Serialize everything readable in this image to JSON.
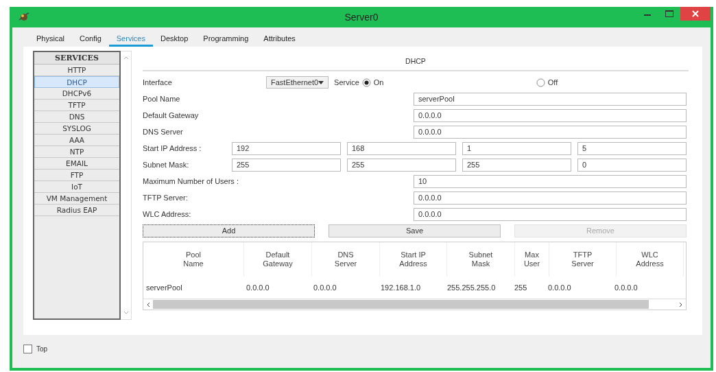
{
  "window": {
    "title": "Server0"
  },
  "tabs": [
    {
      "label": "Physical",
      "selected": false
    },
    {
      "label": "Config",
      "selected": false
    },
    {
      "label": "Services",
      "selected": true
    },
    {
      "label": "Desktop",
      "selected": false
    },
    {
      "label": "Programming",
      "selected": false
    },
    {
      "label": "Attributes",
      "selected": false
    }
  ],
  "sidebar": {
    "title": "SERVICES",
    "items": [
      {
        "label": "HTTP",
        "selected": false
      },
      {
        "label": "DHCP",
        "selected": true
      },
      {
        "label": "DHCPv6",
        "selected": false
      },
      {
        "label": "TFTP",
        "selected": false
      },
      {
        "label": "DNS",
        "selected": false
      },
      {
        "label": "SYSLOG",
        "selected": false
      },
      {
        "label": "AAA",
        "selected": false
      },
      {
        "label": "NTP",
        "selected": false
      },
      {
        "label": "EMAIL",
        "selected": false
      },
      {
        "label": "FTP",
        "selected": false
      },
      {
        "label": "IoT",
        "selected": false
      },
      {
        "label": "VM Management",
        "selected": false
      },
      {
        "label": "Radius EAP",
        "selected": false
      }
    ]
  },
  "panel": {
    "heading": "DHCP",
    "interface": {
      "label": "Interface",
      "value": "FastEthernet0"
    },
    "service": {
      "label": "Service",
      "options": [
        {
          "label": "On",
          "selected": true
        },
        {
          "label": "Off",
          "selected": false
        }
      ]
    },
    "rows": [
      {
        "kind": "text",
        "label": "Pool Name",
        "value": "serverPool"
      },
      {
        "kind": "text",
        "label": "Default Gateway",
        "value": "0.0.0.0"
      },
      {
        "kind": "text",
        "label": "DNS Server",
        "value": "0.0.0.0"
      },
      {
        "kind": "octets",
        "label": "Start IP Address :",
        "values": [
          "192",
          "168",
          "1",
          "5"
        ]
      },
      {
        "kind": "octets",
        "label": "Subnet Mask:",
        "values": [
          "255",
          "255",
          "255",
          "0"
        ]
      },
      {
        "kind": "text",
        "label": "Maximum Number of Users :",
        "value": "10"
      },
      {
        "kind": "text",
        "label": "TFTP Server:",
        "value": "0.0.0.0"
      },
      {
        "kind": "text",
        "label": "WLC Address:",
        "value": "0.0.0.0"
      }
    ],
    "buttons": [
      {
        "label": "Add",
        "focused": true,
        "disabled": false
      },
      {
        "label": "Save",
        "focused": false,
        "disabled": false
      },
      {
        "label": "Remove",
        "focused": false,
        "disabled": true
      }
    ],
    "table": {
      "columns": [
        "Pool Name",
        "Default Gateway",
        "DNS Server",
        "Start IP Address",
        "Subnet Mask",
        "Max User",
        "TFTP Server",
        "WLC Address"
      ],
      "rows": [
        [
          "serverPool",
          "0.0.0.0",
          "0.0.0.0",
          "192.168.1.0",
          "255.255.255.0",
          "255",
          "0.0.0.0",
          "0.0.0.0"
        ]
      ]
    }
  },
  "footer": {
    "checkbox": {
      "label": "Top",
      "checked": false
    }
  }
}
